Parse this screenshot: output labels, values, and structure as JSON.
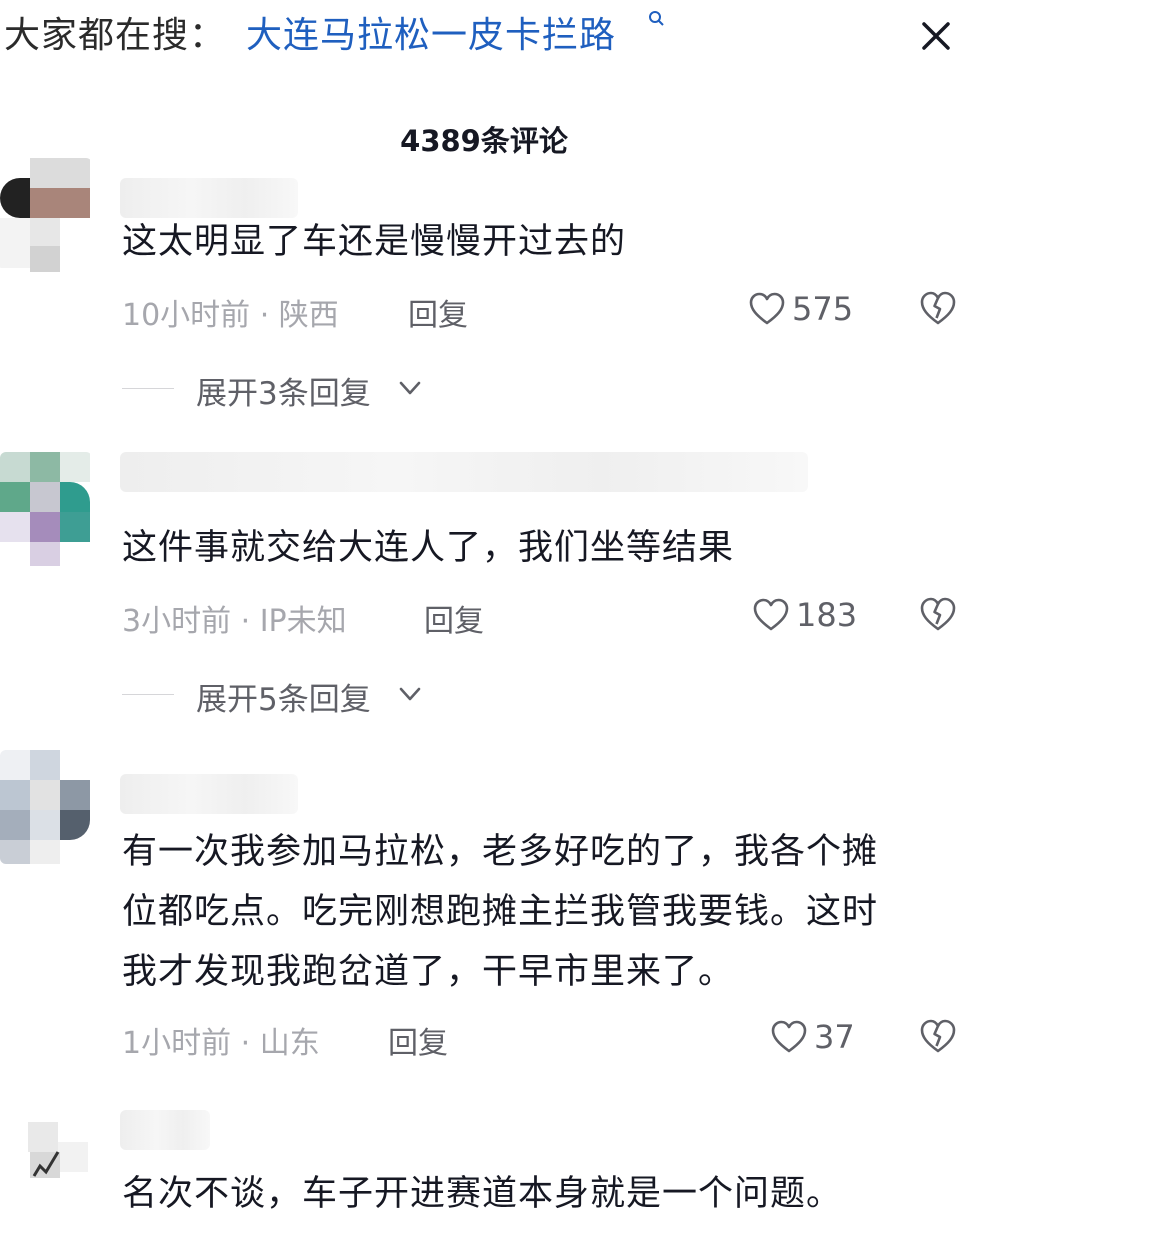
{
  "search": {
    "prefix": "大家都在搜：",
    "term": "大连马拉松一皮卡拦路",
    "term_icon": "search-icon"
  },
  "close_icon": "close-icon",
  "comments_count": "4389条评论",
  "colors": {
    "link_blue": "#1f5fbf",
    "text_primary": "#161823",
    "text_secondary": "#a6a7ad",
    "text_action": "#5f6067"
  },
  "comments": [
    {
      "text": "这太明显了车还是慢慢开过去的",
      "time_location": "10小时前 · 陕西",
      "reply_label": "回复",
      "likes": "575",
      "expand_label": "展开3条回复"
    },
    {
      "text": "这件事就交给大连人了，我们坐等结果",
      "time_location": "3小时前 · IP未知",
      "reply_label": "回复",
      "likes": "183",
      "expand_label": "展开5条回复"
    },
    {
      "text_lines": [
        "有一次我参加马拉松，老多好吃的了，我各个摊",
        "位都吃点。吃完刚想跑摊主拦我管我要钱。这时",
        "我才发现我跑岔道了，干早市里来了。"
      ],
      "time_location": "1小时前 · 山东",
      "reply_label": "回复",
      "likes": "37"
    },
    {
      "text": "名次不谈，车子开进赛道本身就是一个问题。"
    }
  ]
}
